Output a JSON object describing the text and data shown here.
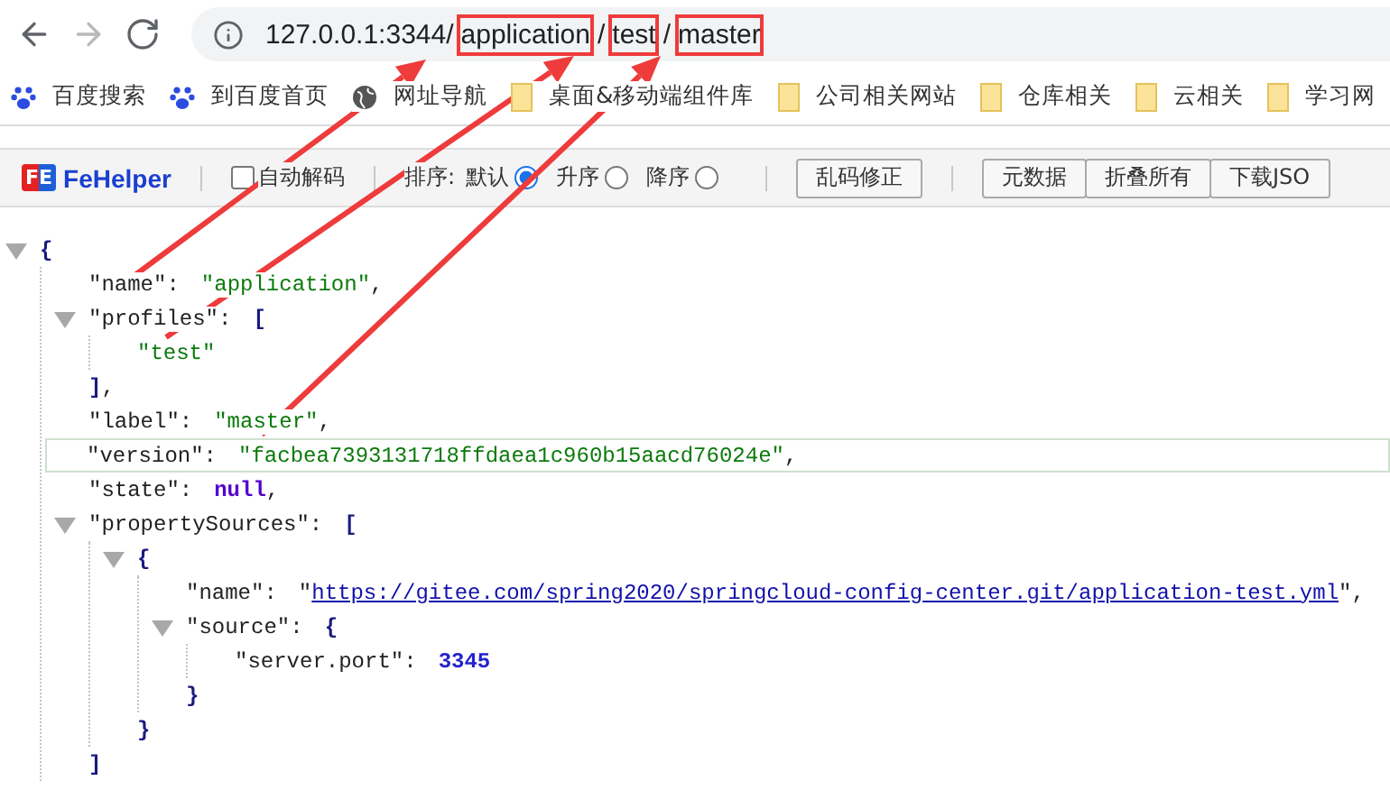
{
  "browser": {
    "nav": [
      {
        "kind": "back",
        "disabled": false
      },
      {
        "kind": "forward",
        "disabled": true
      },
      {
        "kind": "reload",
        "disabled": false
      }
    ],
    "url_segments": [
      {
        "text": "127.0.0.1:3344/",
        "highlighted": false
      },
      {
        "text": "application",
        "highlighted": true
      },
      {
        "text": "/",
        "highlighted": false
      },
      {
        "text": "test",
        "highlighted": true
      },
      {
        "text": "/",
        "highlighted": false
      },
      {
        "text": "master",
        "highlighted": true
      }
    ],
    "bookmarks": [
      {
        "label": "百度搜索",
        "kind": "baidu"
      },
      {
        "label": "到百度首页",
        "kind": "baidu"
      },
      {
        "label": "网址导航",
        "kind": "globe"
      },
      {
        "label": "桌面&移动端组件库",
        "kind": "folder"
      },
      {
        "label": "公司相关网站",
        "kind": "folder"
      },
      {
        "label": "仓库相关",
        "kind": "folder"
      },
      {
        "label": "云相关",
        "kind": "folder"
      },
      {
        "label": "学习网",
        "kind": "folder"
      }
    ]
  },
  "toolbar": {
    "logo_badge": "FE",
    "logo_name": "FeHelper",
    "auto_decode": {
      "label": "自动解码",
      "checked": false
    },
    "sort_label": "排序:",
    "sort_options": [
      {
        "label": "默认",
        "selected": true
      },
      {
        "label": "升序",
        "selected": false
      },
      {
        "label": "降序",
        "selected": false
      }
    ],
    "fix_button": "乱码修正",
    "buttons": [
      "元数据",
      "折叠所有",
      "下载JSO"
    ]
  },
  "json": {
    "kind": "object",
    "open": "{",
    "expanded": true,
    "children": [
      {
        "kind": "string",
        "key": "\"name\":",
        "value": "\"application\"",
        "trail": ","
      },
      {
        "kind": "array",
        "key": "\"profiles\":",
        "open": "[",
        "close": "]",
        "trail": ",",
        "expanded": true,
        "children": [
          {
            "kind": "string",
            "value": "\"test\""
          }
        ]
      },
      {
        "kind": "string",
        "key": "\"label\":",
        "value": "\"master\"",
        "trail": ","
      },
      {
        "kind": "string",
        "key": "\"version\":",
        "value": "\"facbea7393131718ffdaea1c960b15aacd76024e\"",
        "trail": ",",
        "selected": true
      },
      {
        "kind": "null",
        "key": "\"state\":",
        "value": "null",
        "trail": ","
      },
      {
        "kind": "array",
        "key": "\"propertySources\":",
        "open": "[",
        "close": "]",
        "expanded": true,
        "children": [
          {
            "kind": "object",
            "open": "{",
            "close": "}",
            "expanded": true,
            "children": [
              {
                "kind": "link",
                "key": "\"name\":",
                "value": "https://gitee.com/spring2020/springcloud-config-center.git/application-test.yml",
                "quote": "\"",
                "trail": ","
              },
              {
                "kind": "object",
                "key": "\"source\":",
                "open": "{",
                "close": "}",
                "expanded": true,
                "children": [
                  {
                    "kind": "number",
                    "key": "\"server.port\":",
                    "value": "3345"
                  }
                ]
              }
            ]
          }
        ]
      }
    ]
  }
}
